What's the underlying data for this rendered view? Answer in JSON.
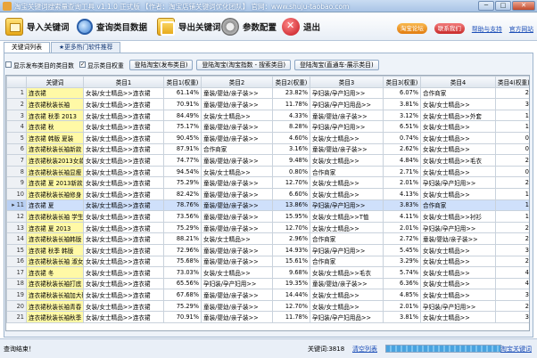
{
  "window": {
    "title": "淘宝关键词搜索量查询工具 v1.1.0 正式版 【作者：淘宝店铺关键词优化团队】 官网：www.shuju-taobao.com",
    "controls": [
      "─",
      "□",
      "✕"
    ]
  },
  "toolbar": {
    "import_label": "导入关键词",
    "query_label": "查询类目数据",
    "export_label": "导出关键词",
    "settings_label": "参数配置",
    "exit_label": "退出",
    "pill_a": "淘宝论坛",
    "pill_b": "联系我们",
    "link_help": "帮助与支持",
    "link_home": "官方网站"
  },
  "tabs": [
    {
      "label": "关键词列表"
    },
    {
      "label": "★更多热门软件推荐"
    }
  ],
  "filters": {
    "show_category_count": {
      "label": "显示发布类目的类目数",
      "checked": false
    },
    "show_category_weight": {
      "label": "显示类目权重",
      "checked": true
    },
    "buttons": [
      "登陆淘宝(发布类目)",
      "登陆淘宝(淘宝指数 - 搜索类目)",
      "登陆淘宝(直通车-展示类目)"
    ]
  },
  "grid": {
    "columns": [
      "",
      "关键词",
      "类目1",
      "类目1(权重)",
      "类目2",
      "类目2(权重)",
      "类目3",
      "类目3(权重)",
      "类目4",
      "类目4(权重)"
    ],
    "rows": [
      [
        "1",
        "连衣裙",
        "女装/女士精品>>连衣裙",
        "61.14%",
        "童装/婴幼/亲子装>>",
        "23.82%",
        "孕妇装/孕产妇用>>",
        "6.07%",
        "合作商家",
        "2"
      ],
      [
        "2",
        "连衣裙秋装长袖",
        "女装/女士精品>>连衣裙",
        "70.91%",
        "童装/婴幼/亲子装>>",
        "11.78%",
        "孕妇装/孕产妇用品>>",
        "3.81%",
        "女装/女士精品>>",
        "3"
      ],
      [
        "3",
        "连衣裙 秋季 2013",
        "女装/女士精品>>连衣裙",
        "84.49%",
        "女装/女士精品>>",
        "4.33%",
        "童装/婴幼/亲子装>>",
        "3.12%",
        "女装/女士精品>>外套",
        "1"
      ],
      [
        "4",
        "连衣裙 秋",
        "女装/女士精品>>连衣裙",
        "75.17%",
        "童装/婴幼/亲子装>>",
        "8.28%",
        "孕妇装/孕产妇用>>",
        "6.51%",
        "女装/女士精品>>",
        "1"
      ],
      [
        "5",
        "连衣裙 韩版 夏装",
        "女装/女士精品>>连衣裙",
        "90.45%",
        "童装/婴幼/亲子装>>",
        "4.60%",
        "女装/女士精品>>",
        "0.74%",
        "女装/女士精品>>",
        "0"
      ],
      [
        "6",
        "连衣裙秋装长袖新款",
        "女装/女士精品>>连衣裙",
        "87.91%",
        "合作商家",
        "3.16%",
        "童装/婴幼/亲子装>>",
        "2.62%",
        "女装/女士精品>>",
        "0"
      ],
      [
        "7",
        "连衣裙秋装2013女款",
        "女装/女士精品>>连衣裙",
        "74.77%",
        "童装/婴幼/亲子装>>",
        "9.48%",
        "女装/女士精品>>",
        "4.84%",
        "女装/女士精品>>毛衣",
        "2"
      ],
      [
        "8",
        "连衣裙秋装长袖显瘦",
        "女装/女士精品>>连衣裙",
        "94.54%",
        "女装/女士精品>>",
        "0.80%",
        "合作商家",
        "2.71%",
        "女装/女士精品>>",
        "0"
      ],
      [
        "9",
        "连衣裙 夏 2013新款",
        "女装/女士精品>>连衣裙",
        "75.29%",
        "童装/婴幼/亲子装>>",
        "12.70%",
        "女装/女士精品>>",
        "2.01%",
        "孕妇装/孕产妇用>>",
        "2"
      ],
      [
        "10",
        "连衣裙秋装长袖修身",
        "女装/女士精品>>连衣裙",
        "82.42%",
        "童装/婴幼/亲子装>>",
        "6.60%",
        "女装/女士精品>>",
        "4.13%",
        "女装/女士精品>>",
        "1"
      ],
      [
        "11",
        "连衣裙 夏",
        "女装/女士精品>>连衣裙",
        "78.76%",
        "童装/婴幼/亲子装>>",
        "13.86%",
        "孕妇装/孕产妇用>>",
        "3.83%",
        "合作商家",
        "1"
      ],
      [
        "12",
        "连衣裙秋装长袖 学生",
        "女装/女士精品>>连衣裙",
        "73.56%",
        "童装/婴幼/亲子装>>",
        "15.95%",
        "女装/女士精品>>T恤",
        "4.11%",
        "女装/女士精品>>衬衫",
        "1"
      ],
      [
        "13",
        "连衣裙 夏 2013",
        "女装/女士精品>>连衣裙",
        "75.29%",
        "童装/婴幼/亲子装>>",
        "12.70%",
        "女装/女士精品>>",
        "2.01%",
        "孕妇装/孕产妇用>>",
        "2"
      ],
      [
        "14",
        "连衣裙秋装长袖韩版",
        "女装/女士精品>>连衣裙",
        "88.21%",
        "女装/女士精品>>",
        "2.96%",
        "合作商家",
        "2.72%",
        "童装/婴幼/亲子装>>",
        "2"
      ],
      [
        "15",
        "连衣裙 秋季 韩版",
        "女装/女士精品>>连衣裙",
        "72.96%",
        "童装/婴幼/亲子装>>",
        "14.93%",
        "孕妇装/孕产妇用>>",
        "5.45%",
        "女装/女士精品>>",
        "3"
      ],
      [
        "16",
        "连衣裙秋装长袖 淑女",
        "女装/女士精品>>连衣裙",
        "75.68%",
        "童装/婴幼/亲子装>>",
        "15.61%",
        "合作商家",
        "3.29%",
        "女装/女士精品>>",
        "2"
      ],
      [
        "17",
        "连衣裙 冬",
        "女装/女士精品>>连衣裙",
        "73.03%",
        "女装/女士精品>>",
        "9.68%",
        "女装/女士精品>>毛衣",
        "5.74%",
        "女装/女士精品>>",
        "4"
      ],
      [
        "18",
        "连衣裙秋装长袖打底",
        "女装/女士精品>>连衣裙",
        "65.56%",
        "孕妇装/孕产妇用>>",
        "19.35%",
        "童装/婴幼/亲子装>>",
        "6.36%",
        "女装/女士精品>>",
        "4"
      ],
      [
        "19",
        "连衣裙秋装长袖加大码",
        "女装/女士精品>>连衣裙",
        "67.68%",
        "童装/婴幼/亲子装>>",
        "14.44%",
        "女装/女士精品>>",
        "4.85%",
        "女装/女士精品>>",
        "3"
      ],
      [
        "20",
        "连衣裙秋装长袖青春",
        "女装/女士精品>>连衣裙",
        "75.29%",
        "童装/婴幼/亲子装>>",
        "12.70%",
        "女装/女士精品>>",
        "2.01%",
        "孕妇装/孕产妇用>>",
        "2"
      ],
      [
        "21",
        "连衣裙秋装长袖秋季",
        "女装/女士精品>>连衣裙",
        "70.91%",
        "童装/婴幼/亲子装>>",
        "11.78%",
        "孕妇装/孕产妇用品>>",
        "3.81%",
        "女装/女士精品>>",
        "3"
      ]
    ],
    "selected_row": 11
  },
  "status": {
    "message": "查询结束！",
    "count_label": "关键词:3818",
    "link_label": "清空列表",
    "progress": 1.0,
    "right_link": "淘宝关键词"
  }
}
